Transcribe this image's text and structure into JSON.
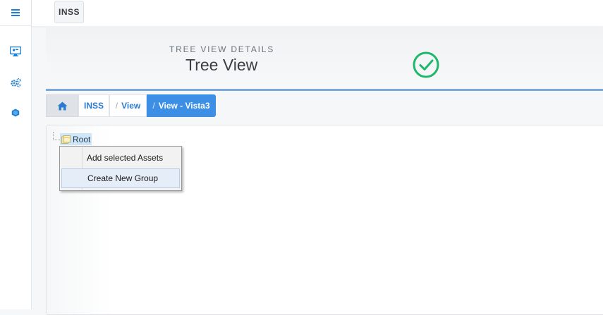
{
  "sidebar": {
    "icons": [
      "hamburger-menu-icon",
      "monitor-icon",
      "cogs-icon",
      "cube-icon"
    ]
  },
  "topbar": {
    "tab_label": "INSS"
  },
  "header": {
    "subtitle": "TREE VIEW DETAILS",
    "title": "Tree View",
    "status_icon": "check-circle-icon",
    "status_color": "#1fb86b"
  },
  "breadcrumb": {
    "home_icon": "home-icon",
    "items": [
      {
        "label": "INSS"
      },
      {
        "slash": "/",
        "label": "View"
      },
      {
        "slash": "/",
        "label": "View - Vista3"
      }
    ]
  },
  "tree": {
    "root_label": "Root"
  },
  "context_menu": {
    "items": [
      {
        "label": "Add selected Assets"
      },
      {
        "label": "Create New Group"
      }
    ]
  },
  "colors": {
    "accent": "#3c8fe4",
    "link": "#2a7ad1",
    "sidebar_icon": "#1e7fd6"
  }
}
